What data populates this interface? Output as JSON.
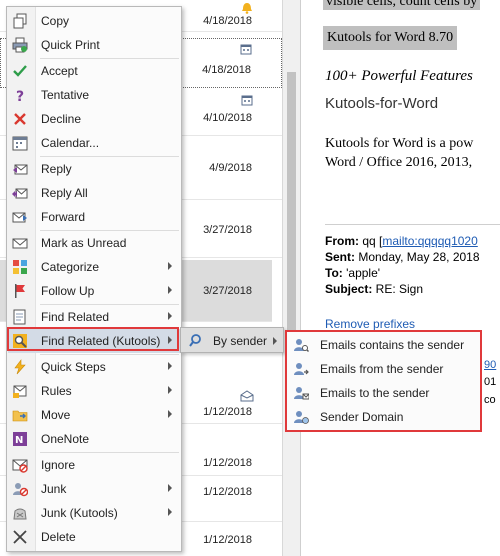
{
  "mail_list": {
    "rows": [
      {
        "date": "4/18/2018",
        "icon": "bell-icon"
      },
      {
        "date": "4/18/2018",
        "icon": "meeting-icon"
      },
      {
        "date": "4/10/2018",
        "icon": "meeting-icon"
      },
      {
        "date": "4/9/2018",
        "icon": ""
      },
      {
        "date": "3/27/2018",
        "icon": ""
      },
      {
        "date": "3/27/2018",
        "icon": ""
      },
      {
        "date": "1/12/2018",
        "icon": "open-envelope-icon"
      },
      {
        "date": "1/12/2018",
        "icon": ""
      },
      {
        "date": "1/12/2018",
        "icon": ""
      },
      {
        "date": "1/12/2018",
        "icon": ""
      }
    ]
  },
  "reading_pane": {
    "line1": "visible cells, count cells by",
    "line2": "Kutools for Word  8.70",
    "line3": "100+ Powerful Features",
    "line4": "Kutools-for-Word",
    "line5": "Kutools for Word is a pow",
    "line6": "Word / Office 2016, 2013,",
    "from_label": "From:",
    "from_value": " qq [",
    "from_link": "mailto:qqqqq1020",
    "sent_label": "Sent:",
    "sent_value": " Monday, May 28, 2018",
    "to_label": "To:",
    "to_value": " 'apple'",
    "subject_label": "Subject:",
    "subject_value": " RE: Sign",
    "remove_prefixes": "Remove prefixes",
    "frag1": "90",
    "frag2": "01",
    "frag3": "co"
  },
  "context_menu": {
    "items": [
      {
        "label": "Copy",
        "icon": "copy-icon"
      },
      {
        "label": "Quick Print",
        "icon": "quick-print-icon"
      },
      {
        "label": "Accept",
        "icon": "check-icon"
      },
      {
        "label": "Tentative",
        "icon": "question-icon"
      },
      {
        "label": "Decline",
        "icon": "x-icon"
      },
      {
        "label": "Calendar...",
        "icon": "calendar-icon"
      },
      {
        "label": "Reply",
        "icon": "reply-icon"
      },
      {
        "label": "Reply All",
        "icon": "reply-all-icon"
      },
      {
        "label": "Forward",
        "icon": "forward-icon"
      },
      {
        "label": "Mark as Unread",
        "icon": "envelope-icon"
      },
      {
        "label": "Categorize",
        "icon": "categorize-icon"
      },
      {
        "label": "Follow Up",
        "icon": "flag-icon"
      },
      {
        "label": "Find Related",
        "icon": "find-related-icon"
      },
      {
        "label": "Find Related (Kutools)",
        "icon": "kutools-find-icon"
      },
      {
        "label": "Quick Steps",
        "icon": "lightning-icon"
      },
      {
        "label": "Rules",
        "icon": "rules-icon"
      },
      {
        "label": "Move",
        "icon": "folder-icon"
      },
      {
        "label": "OneNote",
        "icon": "onenote-icon"
      },
      {
        "label": "Ignore",
        "icon": "ignore-icon"
      },
      {
        "label": "Junk",
        "icon": "junk-icon"
      },
      {
        "label": "Junk (Kutools)",
        "icon": "junk-kutools-icon"
      },
      {
        "label": "Delete",
        "icon": "delete-icon"
      }
    ]
  },
  "submenu_find_related": {
    "by_sender": "By sender"
  },
  "submenu_by_sender": {
    "items": [
      {
        "label": "Emails contains the sender"
      },
      {
        "label": "Emails from the sender"
      },
      {
        "label": "Emails to the sender"
      },
      {
        "label": "Sender Domain"
      }
    ]
  },
  "colors": {
    "highlight_red": "#e0393b",
    "menu_active": "#d3dbe6",
    "link_blue": "#1f5cb4"
  }
}
